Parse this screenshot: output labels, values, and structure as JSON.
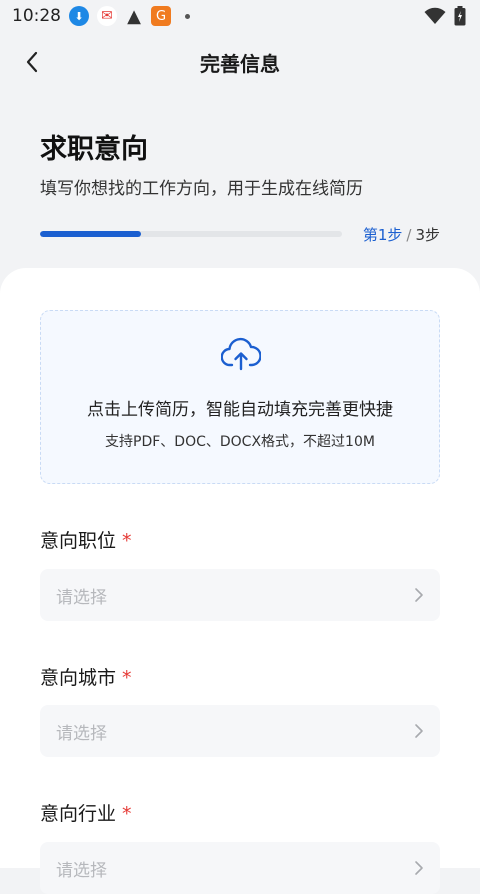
{
  "status_bar": {
    "time": "10:28",
    "icons": [
      "download-icon",
      "red-packet-icon",
      "warning-icon",
      "orange-app-icon",
      "dot-icon",
      "wifi-icon",
      "battery-icon"
    ]
  },
  "header": {
    "title": "完善信息",
    "back_icon": "back-arrow-icon"
  },
  "intro": {
    "title": "求职意向",
    "subtitle": "填写你想找的工作方向，用于生成在线简历"
  },
  "progress": {
    "current_label": "第1步",
    "separator": "/",
    "total_label": "3步",
    "fraction": 0.333,
    "color": "#1b5fd0"
  },
  "upload": {
    "icon": "cloud-upload-icon",
    "main_text": "点击上传简历，智能自动填充完善更快捷",
    "sub_text": "支持PDF、DOC、DOCX格式，不超过10M"
  },
  "fields": [
    {
      "label": "意向职位",
      "required_mark": "*",
      "placeholder": "请选择"
    },
    {
      "label": "意向城市",
      "required_mark": "*",
      "placeholder": "请选择"
    },
    {
      "label": "意向行业",
      "required_mark": "*",
      "placeholder": "请选择"
    }
  ],
  "colors": {
    "accent": "#1b5fd0",
    "required": "#e53935",
    "card_bg": "#ffffff",
    "page_bg": "#f2f3f5"
  }
}
